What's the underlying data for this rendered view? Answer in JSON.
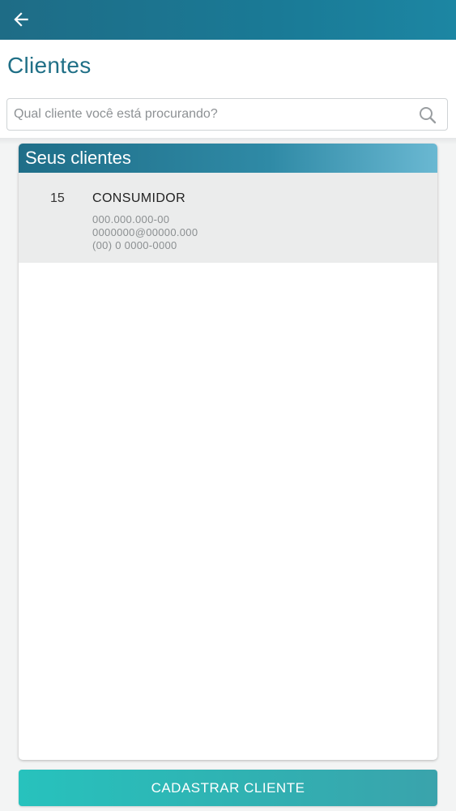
{
  "header": {
    "back_icon": "arrow-left-icon",
    "title": "Clientes"
  },
  "search": {
    "placeholder": "Qual cliente você está procurando?",
    "value": "",
    "icon": "search-icon"
  },
  "clients_section": {
    "title": "Seus clientes",
    "items": [
      {
        "id": "15",
        "name": "CONSUMIDOR",
        "document": "000.000.000-00",
        "email": "0000000@00000.000",
        "phone": "(00) 0 0000-0000"
      }
    ]
  },
  "actions": {
    "register_label": "CADASTRAR CLIENTE"
  },
  "colors": {
    "topbar": "#1a7a96",
    "title_text": "#1f6f86",
    "button": "#2fb3b3"
  }
}
